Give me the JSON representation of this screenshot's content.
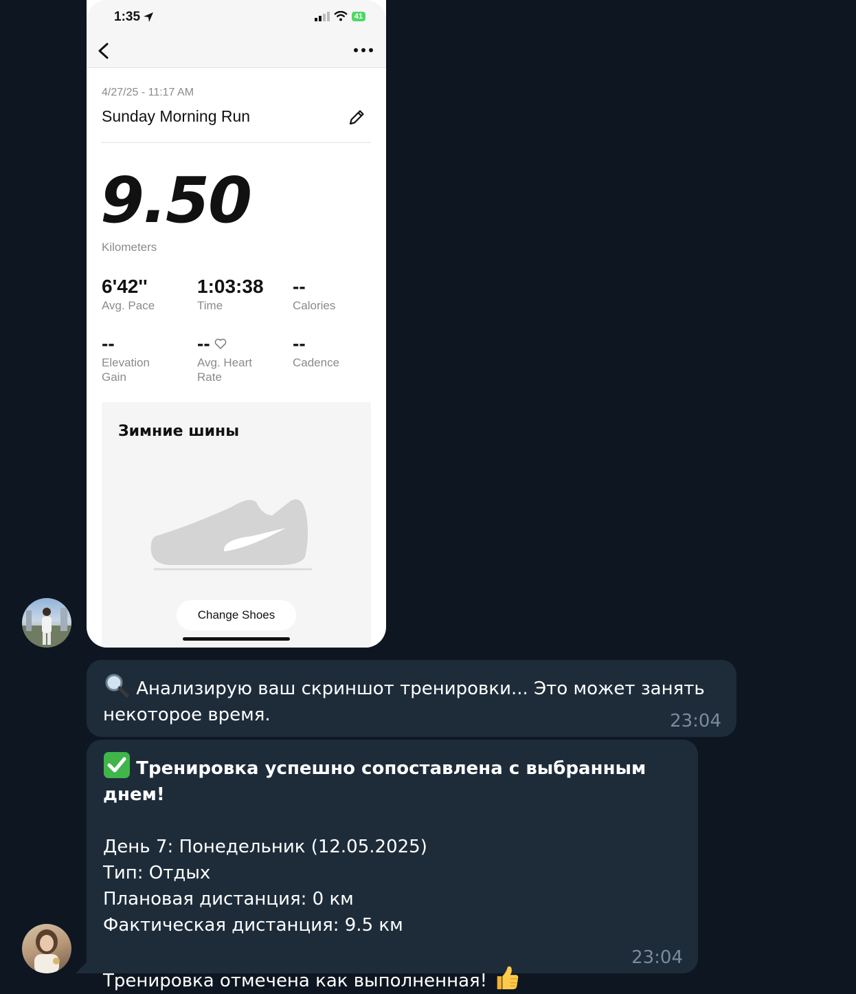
{
  "phone": {
    "status_time": "1:35",
    "battery": "41",
    "date": "4/27/25 - 11:17 AM",
    "title": "Sunday Morning Run",
    "distance": "9.50",
    "distance_unit": "Kilometers",
    "stats": [
      {
        "value": "6'42''",
        "label": "Avg. Pace"
      },
      {
        "value": "1:03:38",
        "label": "Time"
      },
      {
        "value": "--",
        "label": "Calories"
      },
      {
        "value": "--",
        "label": "Elevation Gain"
      },
      {
        "value": "--",
        "label": "Avg. Heart Rate"
      },
      {
        "value": "--",
        "label": "Cadence"
      }
    ],
    "shoe_name": "Зимние шины",
    "change_shoes": "Change Shoes"
  },
  "messages": [
    {
      "text": "Анализирую ваш скриншот тренировки... Это может занять некоторое время.",
      "time": "23:04",
      "icon": "magnifier-icon"
    },
    {
      "headline": "Тренировка успешно сопоставлена с выбранным днем!",
      "lines": [
        "День 7: Понедельник (12.05.2025)",
        "Тип: Отдых",
        "Плановая дистанция: 0 км",
        "Фактическая дистанция: 9.5 км"
      ],
      "footer": "Тренировка отмечена как выполненная!",
      "time": "23:04",
      "icons": [
        "check-mark-icon",
        "thumbs-up-icon"
      ]
    }
  ]
}
